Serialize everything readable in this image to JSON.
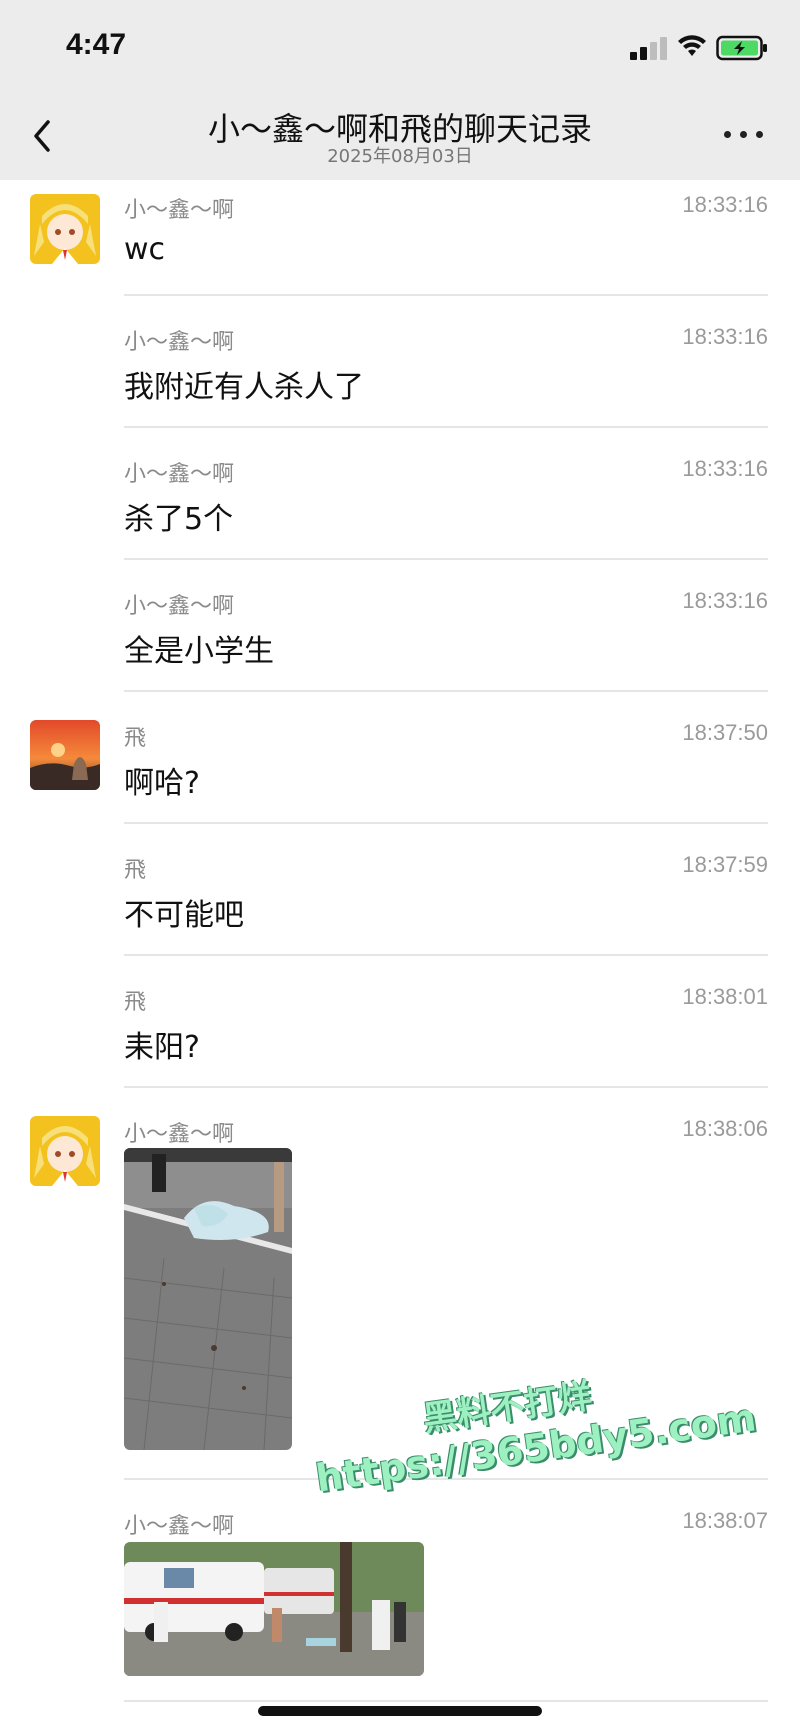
{
  "status_bar": {
    "time": "4:47"
  },
  "nav": {
    "title": "小～鑫～啊和飛的聊天记录",
    "subtitle": "2025年08月03日"
  },
  "messages": [
    {
      "sender": "小～鑫～啊",
      "time": "18:33:16",
      "text": "wc"
    },
    {
      "sender": "小～鑫～啊",
      "time": "18:33:16",
      "text": "我附近有人杀人了"
    },
    {
      "sender": "小～鑫～啊",
      "time": "18:33:16",
      "text": "杀了5个"
    },
    {
      "sender": "小～鑫～啊",
      "time": "18:33:16",
      "text": "全是小学生"
    },
    {
      "sender": "飛",
      "time": "18:37:50",
      "text": "啊哈?"
    },
    {
      "sender": "飛",
      "time": "18:37:59",
      "text": "不可能吧"
    },
    {
      "sender": "飛",
      "time": "18:38:01",
      "text": "耒阳?"
    },
    {
      "sender": "小～鑫～啊",
      "time": "18:38:06",
      "image": "street-photo"
    },
    {
      "sender": "小～鑫～啊",
      "time": "18:38:07",
      "image": "ambulance-photo"
    }
  ],
  "watermark": {
    "line1": "黑料不打烊",
    "line2": "https://365bdy5.com"
  },
  "colors": {
    "header_bg": "#ececec",
    "divider": "#e6e6e6",
    "watermark": "#9df0c0"
  }
}
